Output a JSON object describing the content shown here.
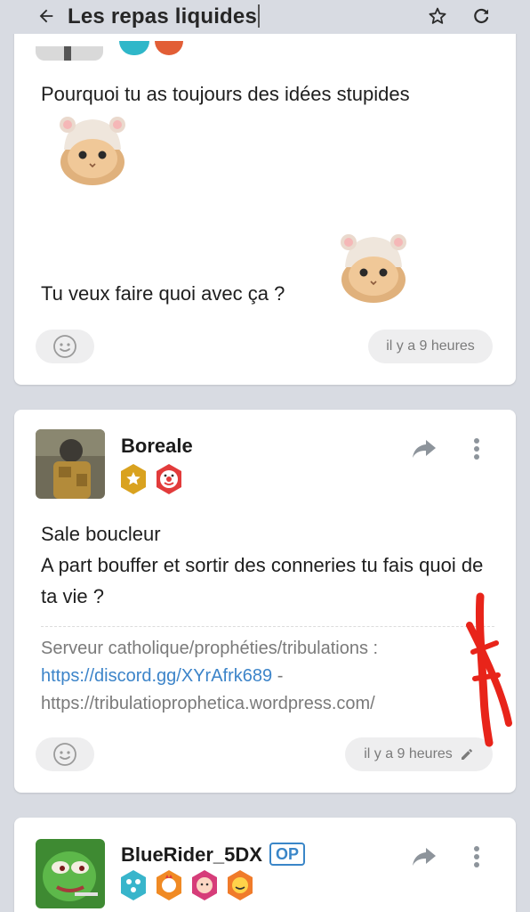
{
  "header": {
    "title": "Les repas liquides"
  },
  "posts": [
    {
      "lines": [
        "Pourquoi tu as toujours des idées stupides",
        "Tu veux faire quoi avec ça ?"
      ],
      "time": "il y a 9 heures"
    },
    {
      "author": "Boreale",
      "body": [
        "Sale boucleur",
        "A part bouffer et sortir des conneries tu fais quoi de ta vie ?"
      ],
      "signature": {
        "label": "Serveur catholique/prophéties/tribulations :",
        "link": "https://discord.gg/XYrAfrk689",
        "sep": " -",
        "url2": "https://tribulatioprophetica.wordpress.com/"
      },
      "time": "il y a 9 heures"
    },
    {
      "author": "BlueRider_5DX",
      "op": "OP"
    }
  ],
  "colors": {
    "background": "#d8dbe2",
    "card": "#ffffff",
    "link": "#3c84c9",
    "op": "#3a86c8",
    "annotation": "#e8241a"
  },
  "icons": [
    "arrow-left-icon",
    "star-icon",
    "refresh-icon",
    "smiley-icon",
    "share-icon",
    "more-vert-icon",
    "pencil-icon"
  ]
}
